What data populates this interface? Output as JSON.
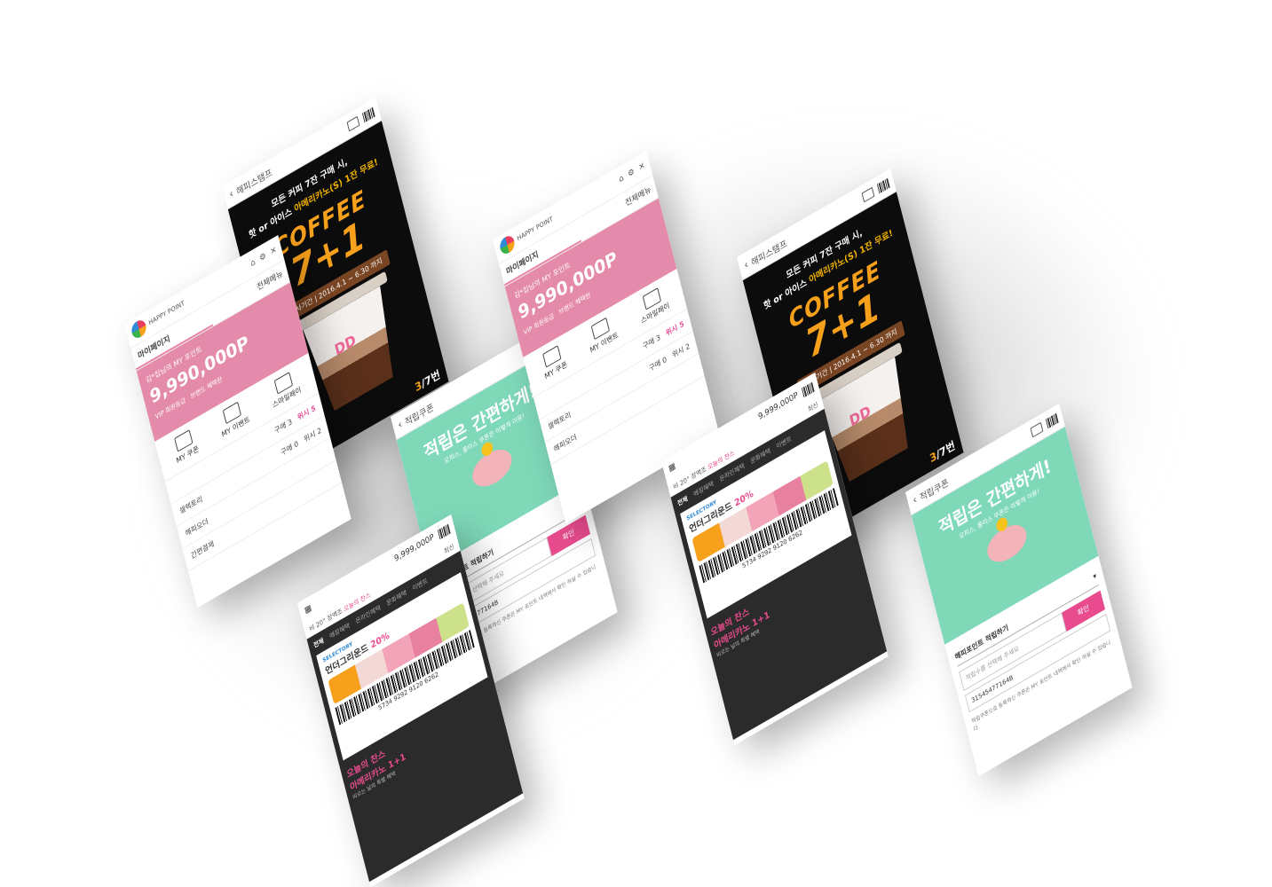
{
  "promo": {
    "header_title": "해피스탬프",
    "line1": "모든 커피 7잔 구매 시,",
    "line2_prefix": "핫 or 아이스 ",
    "line2_highlight": "아메리카노(S) 1잔 무료!",
    "coffee_word": "COFFEE",
    "offer": "7+1",
    "period": "행사기간 | 2016.4.1 ~ 6.30 까지",
    "cup_logo": "DD",
    "page_current": "3",
    "page_total": "/7",
    "page_unit": "번"
  },
  "mypage": {
    "logo_text": "HAPPY POINT",
    "tab_mypage": "마이페이지",
    "tab_all": "전체메뉴",
    "greeting": "김*집님의 MY 포인트",
    "points": "9,990,000P",
    "vip": "VIP 회원등급",
    "brand_benefit": "브랜드 혜택란",
    "icon_coupon": "MY 쿠폰",
    "icon_event": "MY 이벤트",
    "icon_smart": "스마일페이",
    "row1_label": "셀렉토리",
    "row1_a": "구매 3",
    "row1_b": "위시 5",
    "row2_label": "해피오더",
    "row2_a": "구매 0",
    "row2_b": "위시 2",
    "row3_label": "간편결제"
  },
  "saver": {
    "header_title": "적립쿠폰",
    "headline": "적립은 간편하게!",
    "subline": "오피스, 롤미스 쿠폰은 이렇게 이용!",
    "select_label": "해피포인트 적립하기",
    "input_placeholder": "적립수를 선택해 주세요",
    "confirm": "확인",
    "code": "31545477164B",
    "note": "적립쿠폰으로 등록하신 쿠폰은 MY 포인트 내역에서 확인 하실 수 있습니다."
  },
  "coupons": {
    "points": "9,999,000P",
    "sort": "최신",
    "weather": "비 20° 장맥조",
    "today_label": "오늘의 찬스",
    "tabs": [
      "전체",
      "매장혜택",
      "온라인혜택",
      "문화혜택",
      "이벤트"
    ],
    "brand": "SELECTORY",
    "coupon_title_prefix": "언더그리운드 ",
    "coupon_pct": "20%",
    "happy_point": "HAPPY POINT",
    "barcode_number": "5734   9292   9120   6262",
    "chance_title": "오늘의 찬스",
    "chance_offer": "아메리카노 1+1",
    "chance_sub": "비오는 날의 특별 혜택"
  }
}
